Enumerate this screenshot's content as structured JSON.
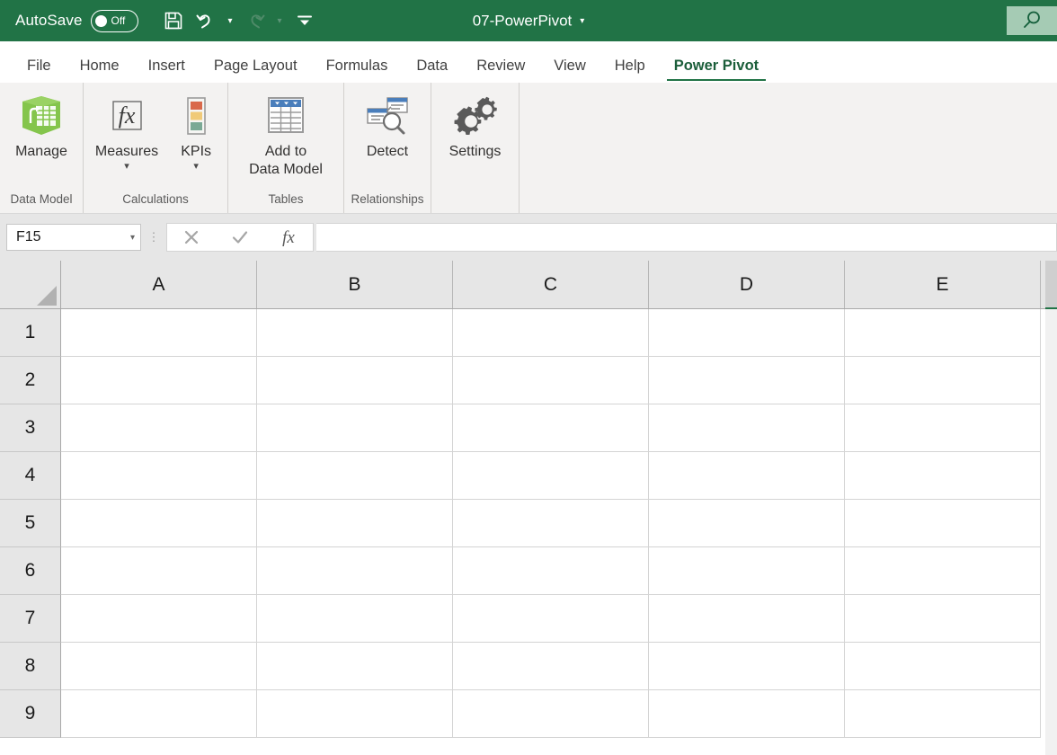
{
  "titlebar": {
    "autosave_label": "AutoSave",
    "autosave_state": "Off",
    "document_title": "07-PowerPivot",
    "title_caret": "▾",
    "qat": [
      {
        "name": "save-icon",
        "label": "Save"
      },
      {
        "name": "undo-icon",
        "label": "Undo"
      },
      {
        "name": "redo-icon",
        "label": "Redo"
      },
      {
        "name": "customize-qat-icon",
        "label": "Customize Quick Access Toolbar"
      }
    ],
    "search_icon": "search-icon",
    "accent_color": "#217346",
    "search_bg": "#a5cbb4"
  },
  "tabs": [
    {
      "label": "File",
      "active": false
    },
    {
      "label": "Home",
      "active": false
    },
    {
      "label": "Insert",
      "active": false
    },
    {
      "label": "Page Layout",
      "active": false
    },
    {
      "label": "Formulas",
      "active": false
    },
    {
      "label": "Data",
      "active": false
    },
    {
      "label": "Review",
      "active": false
    },
    {
      "label": "View",
      "active": false
    },
    {
      "label": "Help",
      "active": false
    },
    {
      "label": "Power Pivot",
      "active": true
    }
  ],
  "ribbon": {
    "groups": [
      {
        "label": "Data Model",
        "items": [
          {
            "label": "Manage",
            "icon": "data-model-cube-icon",
            "has_caret": false
          }
        ]
      },
      {
        "label": "Calculations",
        "items": [
          {
            "label": "Measures",
            "icon": "fx-measures-icon",
            "has_caret": true
          },
          {
            "label": "KPIs",
            "icon": "kpi-bars-icon",
            "has_caret": true
          }
        ]
      },
      {
        "label": "Tables",
        "items": [
          {
            "label": "Add to\nData Model",
            "icon": "add-to-data-model-table-icon",
            "has_caret": false
          }
        ]
      },
      {
        "label": "Relationships",
        "items": [
          {
            "label": "Detect",
            "icon": "detect-relationships-icon",
            "has_caret": false
          }
        ]
      },
      {
        "label": "",
        "items": [
          {
            "label": "Settings",
            "icon": "settings-gears-icon",
            "has_caret": false
          }
        ]
      }
    ],
    "colors": {
      "cube_green": "#7cc04b",
      "kpi_red": "#d9694b",
      "kpi_yellow": "#f0ca78",
      "kpi_teal": "#7aa995",
      "table_header_blue": "#4a7ebb"
    }
  },
  "formula_bar": {
    "name_box_value": "F15",
    "name_box_caret": "▾",
    "cancel_icon": "cancel-x-icon",
    "confirm_icon": "confirm-check-icon",
    "function_icon": "insert-function-fx-icon",
    "formula_value": ""
  },
  "grid": {
    "columns": [
      "A",
      "B",
      "C",
      "D",
      "E"
    ],
    "rows": [
      "1",
      "2",
      "3",
      "4",
      "5",
      "6",
      "7",
      "8",
      "9"
    ],
    "cells": [
      [
        "",
        "",
        "",
        "",
        ""
      ],
      [
        "",
        "",
        "",
        "",
        ""
      ],
      [
        "",
        "",
        "",
        "",
        ""
      ],
      [
        "",
        "",
        "",
        "",
        ""
      ],
      [
        "",
        "",
        "",
        "",
        ""
      ],
      [
        "",
        "",
        "",
        "",
        ""
      ],
      [
        "",
        "",
        "",
        "",
        ""
      ],
      [
        "",
        "",
        "",
        "",
        ""
      ],
      [
        "",
        "",
        "",
        "",
        ""
      ]
    ],
    "select_all_icon": "select-all-corner-icon",
    "scrollbar": "vertical-scrollbar"
  }
}
